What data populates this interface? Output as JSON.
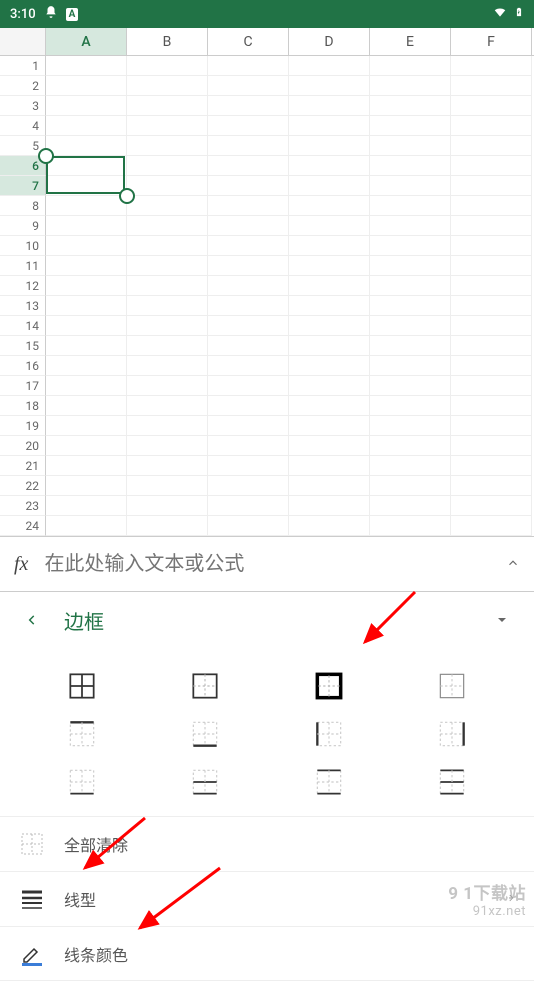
{
  "status": {
    "time": "3:10",
    "bell_icon": "bell-icon",
    "app_icon": "A"
  },
  "columns": [
    "A",
    "B",
    "C",
    "D",
    "E",
    "F"
  ],
  "rows": [
    1,
    2,
    3,
    4,
    5,
    6,
    7,
    8,
    9,
    10,
    11,
    12,
    13,
    14,
    15,
    16,
    17,
    18,
    19,
    20,
    21,
    22,
    23,
    24
  ],
  "selected_col": "A",
  "selected_rows": [
    6,
    7
  ],
  "formula_bar": {
    "label": "fx",
    "placeholder": "在此处输入文本或公式"
  },
  "panel": {
    "title": "边框"
  },
  "border_icons": [
    [
      "border-all",
      "border-inner",
      "border-outside-thick",
      "border-outside-dash"
    ],
    [
      "border-top",
      "border-bottom",
      "border-left",
      "border-right"
    ],
    [
      "border-none-top",
      "border-horizontal",
      "border-inner-h",
      "border-inner-v"
    ]
  ],
  "actions": {
    "clear_all": "全部清除",
    "line_style": "线型",
    "line_color": "线条颜色"
  },
  "watermark": {
    "line1": "9 1下载站",
    "line2": "91xz.net"
  },
  "colors": {
    "brand": "#217346",
    "arrow": "#ff0000"
  }
}
